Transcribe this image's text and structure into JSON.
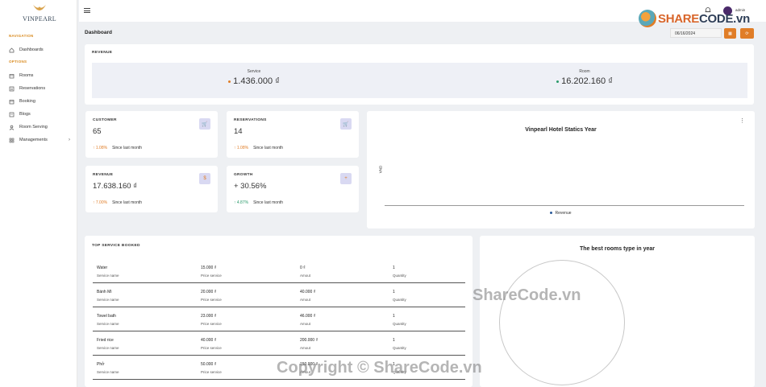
{
  "brand": {
    "name": "VINPEARL"
  },
  "sidebar": {
    "sections": [
      "NAVIGATION",
      "OPTIONS"
    ],
    "items": [
      {
        "label": "Dashboards",
        "icon": "home-icon"
      },
      {
        "label": "Rooms",
        "icon": "calendar-icon"
      },
      {
        "label": "Reservations",
        "icon": "document-icon"
      },
      {
        "label": "Booking",
        "icon": "calendar-icon"
      },
      {
        "label": "Blogs",
        "icon": "document-icon"
      },
      {
        "label": "Room Serving",
        "icon": "user-icon"
      },
      {
        "label": "Managements",
        "icon": "grid-icon"
      }
    ]
  },
  "topbar": {
    "user": "admin"
  },
  "page": {
    "title": "Dashboard",
    "date": "06/16/2024"
  },
  "revenue": {
    "title": "REVENUE",
    "service_label": "Service",
    "service_value": "1.436.000 ₫",
    "service_color": "#e07d27",
    "room_label": "Room",
    "room_value": "16.202.160 ₫",
    "room_color": "#2a9a6a"
  },
  "stats": [
    {
      "title": "CUSTOMER",
      "value": "65",
      "change": "↑ 1.08%",
      "since": "Since last month",
      "color": "#e07d27"
    },
    {
      "title": "RESERVATIONS",
      "value": "14",
      "change": "↑ 1.08%",
      "since": "Since last month",
      "color": "#e07d27"
    },
    {
      "title": "REVENUE",
      "value": "17.638.160 ₫",
      "change": "↑ 7.00%",
      "since": "Since last month",
      "color": "#e07d27"
    },
    {
      "title": "GROWTH",
      "value": "+ 30.56%",
      "change": "↑ 4.87%",
      "since": "Since last month",
      "color": "#2a9a6a"
    }
  ],
  "chart": {
    "title": "Vinpearl Hotel Statics Year",
    "ylabel": "VND",
    "legend": "Revenue"
  },
  "table": {
    "title": "TOP SERVICE BOOKED",
    "labels": [
      "Service name",
      "Price service",
      "Amout",
      "Quantity"
    ],
    "rows": [
      {
        "name": "Water",
        "price": "15.000 ₫",
        "amount": "0 ₫",
        "qty": "1"
      },
      {
        "name": "Bánh Mì",
        "price": "20.000 ₫",
        "amount": "40.000 ₫",
        "qty": "1"
      },
      {
        "name": "Towel bath",
        "price": "23.000 ₫",
        "amount": "46.000 ₫",
        "qty": "1"
      },
      {
        "name": "Fried rice",
        "price": "40.000 ₫",
        "amount": "200.000 ₫",
        "qty": "1"
      },
      {
        "name": "Phở",
        "price": "50.000 ₫",
        "amount": "150.000 ₫",
        "qty": "1"
      }
    ]
  },
  "rooms": {
    "title": "The best rooms type in year"
  },
  "watermark": {
    "logo_a": "SHARE",
    "logo_b": "CODE.vn",
    "mid": "ShareCode.vn",
    "bottom": "Copyright © ShareCode.vn"
  }
}
